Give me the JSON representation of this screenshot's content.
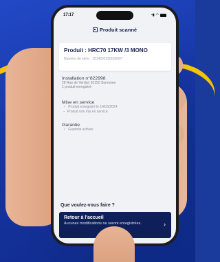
{
  "status_bar": {
    "time": "17:17"
  },
  "app_bar": {
    "title": "Produit scanné",
    "icon": "qr-code-icon"
  },
  "product": {
    "title": "Produit : HRC70 17KW /3 MONO",
    "serial": "Numéro de série : 1514202290000007"
  },
  "installation": {
    "title": "Installation n°822998",
    "address": "28 Rue de Verdun 92150 Suresnes",
    "count": "1 produit enregistré"
  },
  "service": {
    "title": "Mise en service",
    "items": [
      {
        "label": "Produit enregistré le 14/03/2024",
        "icon": "check-icon"
      },
      {
        "label": "Produit non mis en service",
        "icon": "dash-icon"
      }
    ]
  },
  "warranty": {
    "title": "Garantie",
    "items": [
      {
        "label": "Garantie activée",
        "icon": "check-icon"
      }
    ]
  },
  "actions": {
    "question": "Que voulez-vous faire ?",
    "home": {
      "title": "Retour à l'accueil",
      "subtitle": "Aucunes modifications ne seront enregistrées.",
      "icon": "chevron-right-icon"
    }
  },
  "colors": {
    "primary": "#0f1f5a",
    "background_blue": "#1a3a9c",
    "accent_yellow": "#f4c400"
  }
}
